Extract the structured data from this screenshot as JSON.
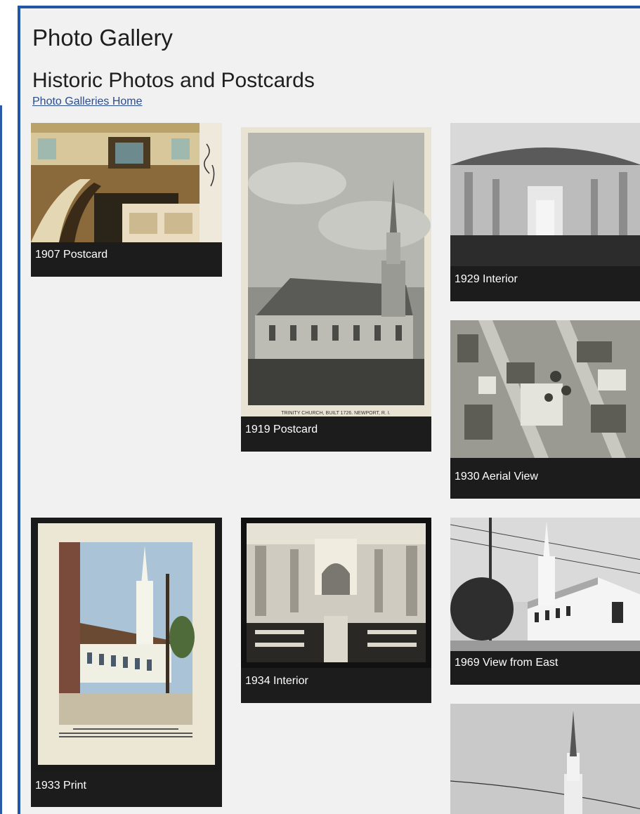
{
  "header": {
    "gallery_title": "Photo Gallery",
    "section_title": "Historic Photos and Postcards",
    "home_link": "Photo Galleries Home"
  },
  "colors": {
    "frame_border": "#1f56a8",
    "panel_bg": "#f1f1f1",
    "caption_bg": "#1c1c1c",
    "link": "#2a4d8f"
  },
  "photos": [
    {
      "caption": "1907 Postcard"
    },
    {
      "caption": "1919 Postcard",
      "print": "TRINITY CHURCH, BUILT 1726.      NEWPORT, R. I."
    },
    {
      "caption": "1929 Interior"
    },
    {
      "caption": "1930 Aerial View"
    },
    {
      "caption": "1933 Print"
    },
    {
      "caption": "1934 Interior"
    },
    {
      "caption": "1969 View from East"
    },
    {
      "caption": ""
    }
  ]
}
